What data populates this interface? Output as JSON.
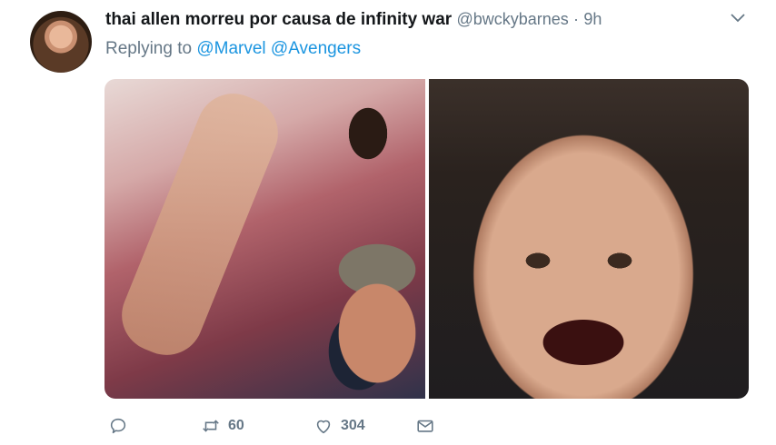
{
  "tweet": {
    "display_name": "thai allen morreu por causa de infinity war",
    "handle": "@bwckybarnes",
    "separator": "·",
    "time": "9h",
    "replying_prefix": "Replying to",
    "mentions": [
      "@Marvel",
      "@Avengers"
    ]
  },
  "actions": {
    "reply_icon": "reply-icon",
    "retweet_icon": "retweet-icon",
    "retweet_count": "60",
    "like_icon": "heart-icon",
    "like_count": "304",
    "dm_icon": "envelope-icon"
  },
  "colors": {
    "link": "#1b95e0",
    "muted": "#657786",
    "text": "#14171a"
  }
}
